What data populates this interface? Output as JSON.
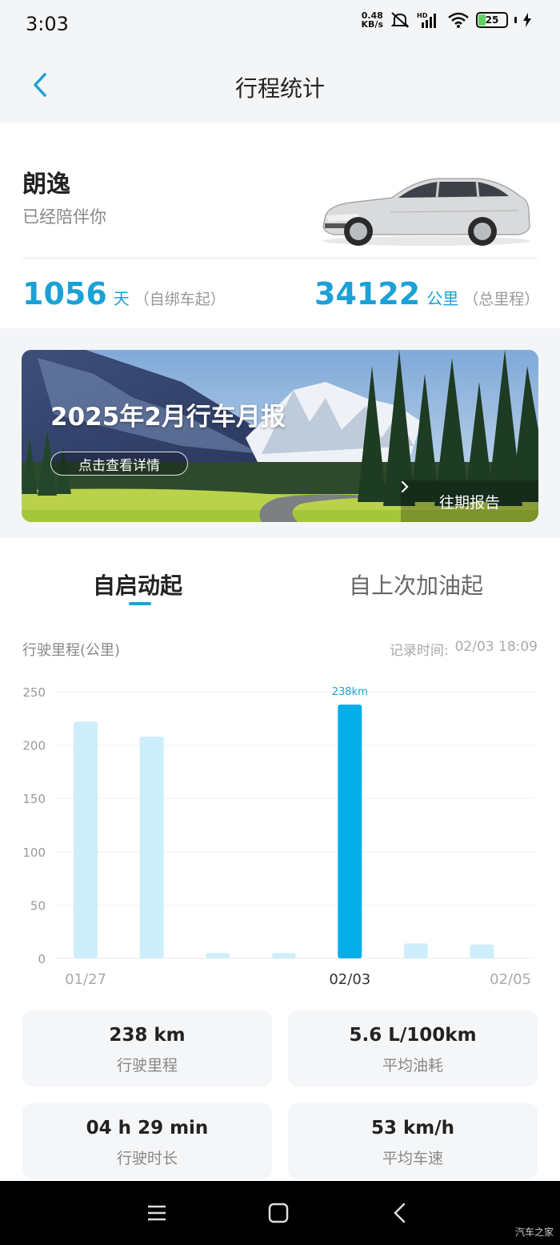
{
  "status_bar": {
    "time": "3:03",
    "net_speed_value": "0.48",
    "net_speed_unit": "KB/s",
    "battery": "25",
    "battery_level": 0.25,
    "icons": [
      "mute-icon",
      "signal-icon",
      "wifi-icon",
      "battery-icon",
      "charging-icon"
    ]
  },
  "header": {
    "title": "行程统计",
    "back_icon": "chevron-left-icon"
  },
  "vehicle": {
    "name": "朗逸",
    "subtitle": "已经陪伴你",
    "days_value": "1056",
    "days_unit": "天",
    "days_note": "（自绑车起）",
    "distance_value": "34122",
    "distance_unit": "公里",
    "distance_note": "（总里程）"
  },
  "banner": {
    "title": "2025年2月行车月报",
    "button_label": "点击查看详情",
    "past_reports_label": "往期报告"
  },
  "tabs": [
    {
      "label": "自启动起",
      "active": true
    },
    {
      "label": "自上次加油起",
      "active": false
    }
  ],
  "chart_section": {
    "label": "行驶里程(公里)",
    "record_time_label": "记录时间:",
    "record_time_value": "02/03 18:09"
  },
  "chart_data": {
    "type": "bar",
    "categories": [
      "01/27",
      "",
      "",
      "",
      "02/03",
      "",
      "02/05"
    ],
    "values": [
      222,
      208,
      5,
      5,
      238,
      14,
      13
    ],
    "highlight_index": 4,
    "highlight_label": "238km",
    "ylim": [
      0,
      250
    ],
    "yticks": [
      0,
      50,
      100,
      150,
      200,
      250
    ],
    "xlabel": "",
    "ylabel": "",
    "grid": true,
    "colors": {
      "normal": "#cdeefa",
      "highlight": "#05aee9"
    }
  },
  "metrics": [
    {
      "value": "238 km",
      "label": "行驶里程"
    },
    {
      "value": "5.6 L/100km",
      "label": "平均油耗"
    },
    {
      "value": "04 h 29 min",
      "label": "行驶时长"
    },
    {
      "value": "53 km/h",
      "label": "平均车速"
    }
  ],
  "system_nav": {
    "items": [
      "menu-icon",
      "home-icon",
      "back-icon"
    ],
    "watermark": "汽车之家"
  },
  "colors": {
    "accent": "#1aa1d6",
    "bar_highlight": "#05aee9",
    "bar_normal": "#cdeefa"
  }
}
